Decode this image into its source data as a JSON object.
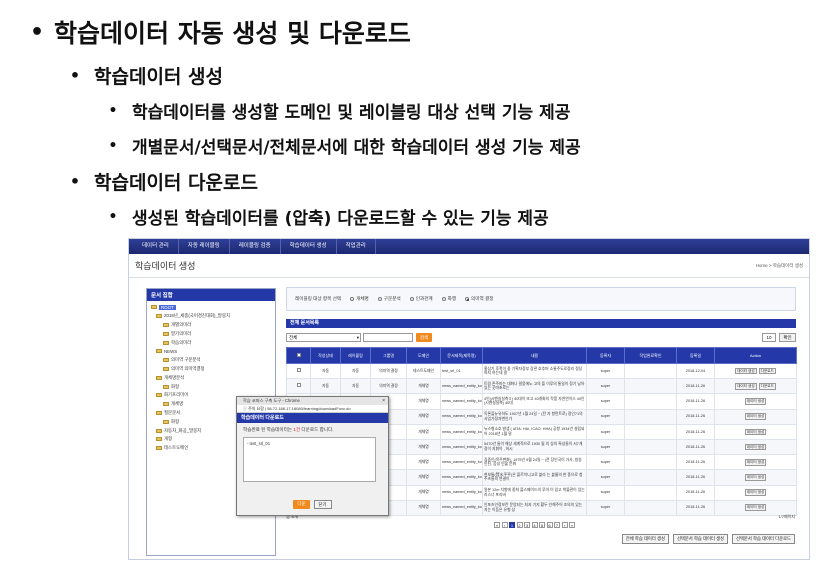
{
  "slide": {
    "bullets": [
      {
        "text": "학습데이터 자동 생성 및 다운로드"
      },
      {
        "text": "학습데이터 생성"
      },
      {
        "text": "학습데이터를 생성할 도메인 및 레이블링 대상 선택 기능 제공"
      },
      {
        "text": "개별문서/선택문서/전체문서에 대한 학습데이터 생성 기능 제공"
      },
      {
        "text": "학습데이터 다운로드"
      },
      {
        "text": "생성된 학습데이터를 (압축) 다운로드할 수 있는 기능 제공"
      }
    ],
    "bullet_glyph": "•",
    "subbullet_glyph": "•"
  },
  "app": {
    "nav": [
      "데이터 관리",
      "자동 레이블링",
      "레이블링 검증",
      "학습데이터 생성",
      "작업관리"
    ],
    "page_title": "학습데이터 생성",
    "breadcrumb": "Home > 학습데이터 생성",
    "doc_box": {
      "title": "문서 집합",
      "tree": [
        {
          "label": "ROOT",
          "level": 0,
          "selected": true
        },
        {
          "label": "2018년_세종(국어경진대회)_말뭉치",
          "level": 1
        },
        {
          "label": "개별의미라",
          "level": 2
        },
        {
          "label": "말기의미라",
          "level": 2
        },
        {
          "label": "학습의미라",
          "level": 2
        },
        {
          "label": "NEWS",
          "level": 1
        },
        {
          "label": "의미역 구문분석",
          "level": 2
        },
        {
          "label": "의미역 의미역결정",
          "level": 2
        },
        {
          "label": "개체명분석",
          "level": 1
        },
        {
          "label": "화형",
          "level": 2
        },
        {
          "label": "화기프리미어",
          "level": 1
        },
        {
          "label": "개체명",
          "level": 2
        },
        {
          "label": "질문문서",
          "level": 1
        },
        {
          "label": "화형",
          "level": 2
        },
        {
          "label": "자동차_화공_말뭉치",
          "level": 1
        },
        {
          "label": "개형",
          "level": 1
        },
        {
          "label": "테스트도메인",
          "level": 1
        }
      ]
    },
    "filter": {
      "label": "레이블링 대상 항목 선택",
      "options": [
        {
          "label": "개체명",
          "checked": false
        },
        {
          "label": "구문분석",
          "checked": false
        },
        {
          "label": "인과관계",
          "checked": false
        },
        {
          "label": "화행",
          "checked": false
        },
        {
          "label": "의미역 결정",
          "checked": true
        }
      ]
    },
    "list": {
      "title": "전체 문서목록",
      "scope_select": "전체",
      "search_button": "검색",
      "page_size": "10",
      "apply_button": "확인",
      "columns": [
        "",
        "작성상태",
        "레이블링",
        "그룹명",
        "도메인",
        "문서제목(제목명)",
        "내용",
        "등록자",
        "작업완료확인",
        "등록일",
        "Action"
      ],
      "rows": [
        {
          "state": "자동",
          "label": "자동",
          "group": "의미역 결정",
          "domain": "테스트도메인",
          "title": "test_srl_01",
          "content": "홍상기 후폭이 중 기획자정부 장관 호추머 소통주도로정리 정당하지 하는데 말",
          "user": "super",
          "done": "",
          "date": "2018-12-04",
          "actions": [
            "데이터 생성",
            "다운로드"
          ]
        },
        {
          "state": "자동",
          "label": "자동",
          "group": "의미역 결정",
          "domain": "개체명",
          "title": "news_named_entity_korean_13",
          "content": "트럼 존주마는 대화나 말뭉에노 고의 플 이루의 통일이 정기 남아 있는 곳마초로는",
          "user": "super",
          "done": "",
          "date": "2018-11-26",
          "actions": [
            "데이터 생성",
            "다운로드"
          ]
        },
        {
          "state": "",
          "label": "",
          "group": "",
          "domain": "개체명",
          "title": "news_named_entity_korean_14",
          "content": "4인(시벤실실측ㅎ) 40대이 또고 40개회의 작품 자연연이스 40인(시벤실실측) 40대",
          "user": "super",
          "done": "",
          "date": "2018-11-26",
          "actions": [
            "데이터 생성"
          ]
        },
        {
          "state": "",
          "label": "",
          "group": "",
          "domain": "개체명",
          "title": "news_named_entity_korean_12",
          "content": "독론을뉴유하도 1907년 1월 24일 ~ (전 자 항먼트로) 정인71의 사업가정자변인가",
          "user": "super",
          "done": "",
          "date": "2018-11-26",
          "actions": [
            "데이터 생성"
          ]
        },
        {
          "state": "",
          "label": "",
          "group": "",
          "domain": "개체명",
          "title": "news_named_entity_korean_11",
          "content": "뉴스형소호 발생 ( IATA: HAI, ICAO: HHA) 공항 1934년 설립되어 2018년 1월 말",
          "user": "super",
          "done": "",
          "date": "2018-11-26",
          "actions": [
            "데이터 생성"
          ]
        },
        {
          "state": "",
          "label": "",
          "group": "",
          "domain": "개체명",
          "title": "news_named_entity_korean_10",
          "content": "5470년 들이 해상 세계적으로 1930 될 의 상의 특성들이 서7개정이 지휘이 , 하시",
          "user": "super",
          "done": "",
          "date": "2018-11-26",
          "actions": [
            "데이터 생성"
          ]
        },
        {
          "state": "",
          "label": "",
          "group": "",
          "domain": "개체명",
          "title": "news_named_entity_korean_9",
          "content": "집중인(목주변화), 1975년 9월 24일 ~ (전 장인국이 가사, 방송인된, 음성 인물 문화",
          "user": "super",
          "done": "",
          "date": "2018-11-26",
          "actions": [
            "데이터 생성"
          ]
        },
        {
          "state": "",
          "label": "",
          "group": "",
          "domain": "개체명",
          "title": "news_named_entity_korean_8",
          "content": "현보통(賢水平平)은 플르이니고로 블라 는 블룸의 한 종으로 청주츠들의 연결이",
          "user": "super",
          "done": "",
          "date": "2018-11-26",
          "actions": [
            "데이터 생성"
          ]
        },
        {
          "state": "",
          "label": "",
          "group": "",
          "domain": "개체명",
          "title": "news_named_entity_korean_7",
          "content": "일본 12m 치항에 종쳐 플스페이드의 루아 이 있고 박물관이 있는 리스너 프리바",
          "user": "super",
          "done": "",
          "date": "2018-11-26",
          "actions": [
            "데이터 생성"
          ]
        },
        {
          "state": "",
          "label": "",
          "group": "",
          "domain": "개체명",
          "title": "news_named_entity_korean_6",
          "content": "인포츠인정보란 문양되는 처과 기지 황두 인해주어 조의의 있는지는 이듬은 유형 상",
          "user": "super",
          "done": "",
          "date": "2018-11-26",
          "actions": [
            "데이터 생성"
          ]
        }
      ],
      "total_label": "총 8개",
      "count_label": "1/7페이지",
      "pages": [
        "«",
        "‹",
        "1",
        "2",
        "3",
        "4",
        "5",
        "6",
        "7",
        "›",
        "»"
      ],
      "current_page": "1",
      "bottom_buttons": [
        "전체 학습 데이터 생성",
        "선택문서 학습 데이터 생성",
        "선택문서 학습 데이터 다운로드"
      ]
    },
    "popup": {
      "window_title": "학습 코퍼스 구축 도구 - Chrome",
      "url": "ⓘ 주의 요함 | 58.72.188.17:18080/learning/downloadFoxx.do",
      "header": "학습데이터 다운로드",
      "message_prefix": "학습완료 된 학습데이터는 ",
      "message_count": "1건",
      "message_suffix": " 다운로드 합니다.",
      "files": [
        "- test_srl_01"
      ],
      "download_button": "다운",
      "close_button": "닫기"
    },
    "colors": {
      "nav": "#1c2870",
      "header": "#2438a8",
      "accent": "#f08a1e"
    }
  }
}
